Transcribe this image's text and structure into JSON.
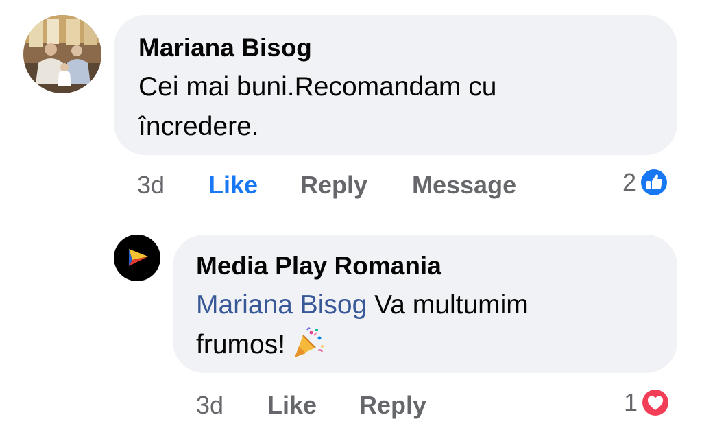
{
  "comment": {
    "author": "Mariana Bisog",
    "text": "Cei mai buni.Recomandam cu încredere.",
    "time": "3d",
    "like_label": "Like",
    "reply_label": "Reply",
    "message_label": "Message",
    "reaction_count": "2",
    "reaction_type": "like-icon",
    "like_color": "#1877f2"
  },
  "reply": {
    "author": "Media Play Romania",
    "mention": "Mariana Bisog",
    "text": " Va multumim frumos!",
    "emoji": "party-popper-icon",
    "time": "3d",
    "like_label": "Like",
    "reply_label": "Reply",
    "reaction_count": "1",
    "reaction_type": "love-icon",
    "mention_color": "#385898"
  },
  "colors": {
    "bubble": "#f0f2f5",
    "secondary_text": "#65676b",
    "love": "#f33e58"
  }
}
